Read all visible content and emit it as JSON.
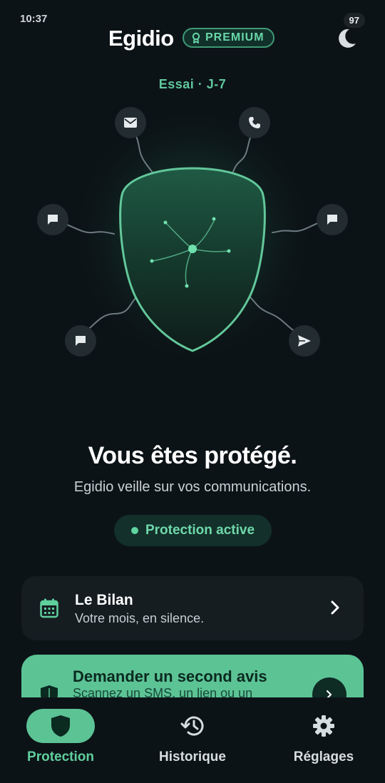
{
  "status_bar": {
    "time": "10:37",
    "battery": "97"
  },
  "header": {
    "title": "Egidio",
    "badge": "PREMIUM",
    "theme_icon": "moon-icon"
  },
  "trial": {
    "label": "Essai · J-7"
  },
  "shield": {
    "nodes": [
      "mail-icon",
      "phone-icon",
      "chat-icon",
      "chat-icon",
      "chat-icon",
      "send-icon"
    ]
  },
  "hero": {
    "title": "Vous êtes protégé.",
    "subtitle": "Egidio veille sur vos communications."
  },
  "status_pill": {
    "label": "Protection active",
    "color": "#5fd3a0"
  },
  "bilan": {
    "title": "Le Bilan",
    "subtitle": "Votre mois, en silence.",
    "icon": "calendar-icon"
  },
  "avis": {
    "title": "Demander un second avis",
    "subtitle": "Scannez un SMS, un lien ou un",
    "icon": "shield-check-icon"
  },
  "nav": {
    "items": [
      {
        "label": "Protection",
        "icon": "shield-icon",
        "active": true
      },
      {
        "label": "Historique",
        "icon": "history-icon",
        "active": false
      },
      {
        "label": "Réglages",
        "icon": "gear-icon",
        "active": false
      }
    ]
  },
  "colors": {
    "accent": "#5cc395",
    "background": "#0c1317",
    "card": "#151d21"
  }
}
